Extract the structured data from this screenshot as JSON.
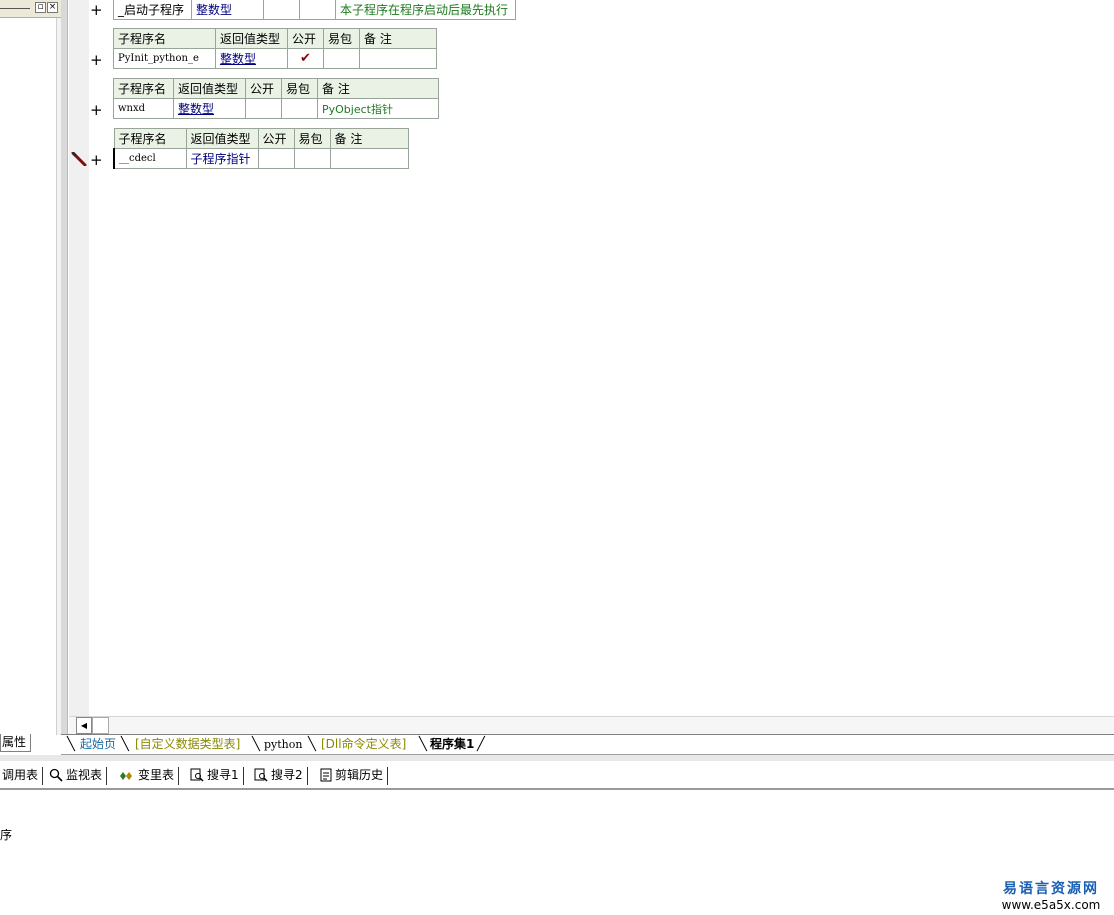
{
  "first_row": {
    "name": "_启动子程序",
    "return_type": "整数型",
    "public": "",
    "easy": "",
    "remark": "本子程序在程序启动后最先执行"
  },
  "table_headers": {
    "name": "子程序名",
    "return_type": "返回值类型",
    "public": "公开",
    "easy": "易包",
    "remark": "备 注"
  },
  "subroutines": [
    {
      "name": "PyInit_python_e",
      "return_type": "整数型",
      "public": "✔",
      "easy": "",
      "remark": ""
    },
    {
      "name": "wnxd",
      "return_type": "整数型",
      "public": "",
      "easy": "",
      "remark": "PyObject指针"
    },
    {
      "name": "__cdecl",
      "return_type": "子程序指针",
      "public": "",
      "easy": "",
      "remark": ""
    }
  ],
  "expand_symbol": "+",
  "left_panel": {
    "restore_symbol": "▫",
    "close_symbol": "×",
    "properties_tab": "属性"
  },
  "doc_tabs": [
    "起始页",
    "[自定义数据类型表]",
    "python",
    "[Dll命令定义表]",
    "程序集1"
  ],
  "bottom_toolbar": [
    {
      "label": "调用表",
      "icon": "table-icon"
    },
    {
      "label": "监视表",
      "icon": "magnifier-icon"
    },
    {
      "label": "变里表",
      "icon": "variable-icon"
    },
    {
      "label": "搜寻1",
      "icon": "search-doc-icon"
    },
    {
      "label": "搜寻2",
      "icon": "search-doc-icon"
    },
    {
      "label": "剪辑历史",
      "icon": "clipboard-icon"
    }
  ],
  "output_text": "序",
  "watermark": {
    "title": "易语言资源网",
    "url": "www.e5a5x.com"
  },
  "colors": {
    "header_bg": "#eaf2e6",
    "type_blue": "#000080",
    "remark_green": "#1f7a1f",
    "check_red": "#8b0000",
    "watermark_blue": "#1a5fb4"
  }
}
